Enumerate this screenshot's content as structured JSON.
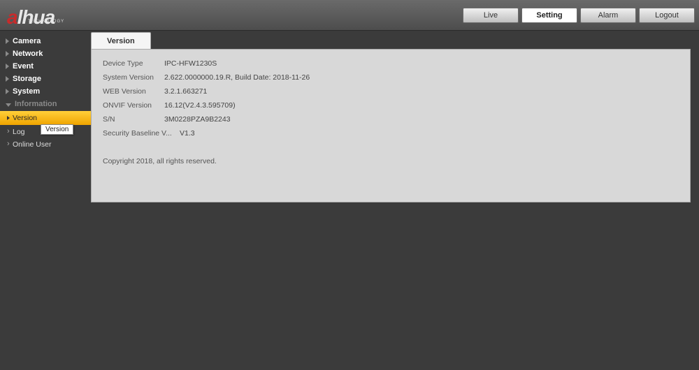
{
  "header": {
    "logo_main": "alhua",
    "logo_sub": "TECHNOLOGY",
    "nav": {
      "live": "Live",
      "setting": "Setting",
      "alarm": "Alarm",
      "logout": "Logout"
    }
  },
  "sidebar": {
    "camera": "Camera",
    "network": "Network",
    "event": "Event",
    "storage": "Storage",
    "system": "System",
    "information": "Information",
    "subs": {
      "version": "Version",
      "log": "Log",
      "online_user": "Online User"
    },
    "tooltip": "Version"
  },
  "content": {
    "tab_label": "Version",
    "rows": [
      {
        "label": "Device Type",
        "value": "IPC-HFW1230S"
      },
      {
        "label": "System Version",
        "value": "2.622.0000000.19.R, Build Date: 2018-11-26"
      },
      {
        "label": "WEB Version",
        "value": "3.2.1.663271"
      },
      {
        "label": "ONVIF Version",
        "value": "16.12(V2.4.3.595709)"
      },
      {
        "label": "S/N",
        "value": "3M0228PZA9B2243"
      },
      {
        "label": "Security Baseline V...",
        "value": "V1.3"
      }
    ],
    "copyright": "Copyright 2018, all rights reserved."
  }
}
